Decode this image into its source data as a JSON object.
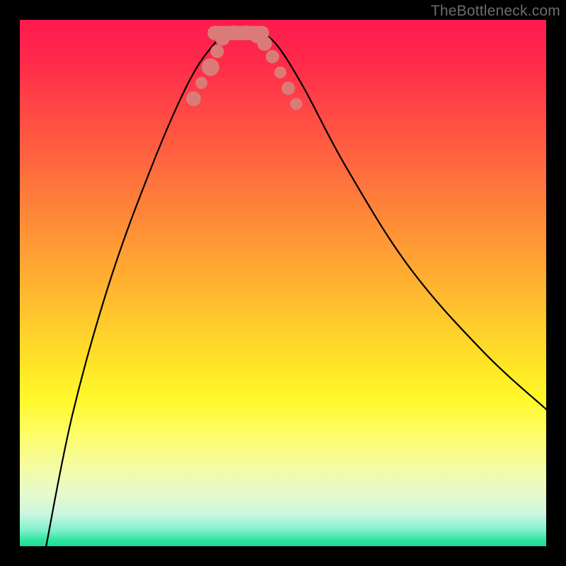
{
  "watermark": "TheBottleneck.com",
  "chart_data": {
    "type": "line",
    "title": "",
    "xlabel": "",
    "ylabel": "",
    "xlim": [
      0,
      100
    ],
    "ylim": [
      0,
      100
    ],
    "grid": false,
    "legend": false,
    "series": [
      {
        "name": "left-branch",
        "path": [
          {
            "x": 5,
            "y": 0
          },
          {
            "x": 10,
            "y": 25
          },
          {
            "x": 17,
            "y": 50
          },
          {
            "x": 25,
            "y": 72
          },
          {
            "x": 32,
            "y": 88
          },
          {
            "x": 37,
            "y": 95.5
          },
          {
            "x": 40,
            "y": 97.5
          }
        ]
      },
      {
        "name": "right-branch",
        "path": [
          {
            "x": 46,
            "y": 97.5
          },
          {
            "x": 49,
            "y": 95
          },
          {
            "x": 54,
            "y": 87
          },
          {
            "x": 62,
            "y": 72
          },
          {
            "x": 74,
            "y": 53
          },
          {
            "x": 88,
            "y": 37
          },
          {
            "x": 100,
            "y": 26
          }
        ]
      }
    ],
    "trough": {
      "x_start": 37,
      "x_end": 46,
      "y": 97.5
    },
    "markers": [
      {
        "x": 33,
        "y": 85,
        "r": 10
      },
      {
        "x": 34.5,
        "y": 88,
        "r": 8
      },
      {
        "x": 36.2,
        "y": 91,
        "r": 12
      },
      {
        "x": 37.5,
        "y": 94,
        "r": 9
      },
      {
        "x": 38.5,
        "y": 96.5,
        "r": 10
      },
      {
        "x": 40.5,
        "y": 97.5,
        "r": 10
      },
      {
        "x": 43,
        "y": 97.5,
        "r": 10
      },
      {
        "x": 45,
        "y": 97,
        "r": 10
      },
      {
        "x": 46.5,
        "y": 95.5,
        "r": 10
      },
      {
        "x": 48,
        "y": 93,
        "r": 9
      },
      {
        "x": 49.5,
        "y": 90,
        "r": 8
      },
      {
        "x": 51,
        "y": 87,
        "r": 9
      },
      {
        "x": 52.5,
        "y": 84,
        "r": 8
      }
    ],
    "background_gradient": {
      "top": "#ff1a4f",
      "mid": "#ffe626",
      "bottom": "#1fdc95"
    }
  }
}
